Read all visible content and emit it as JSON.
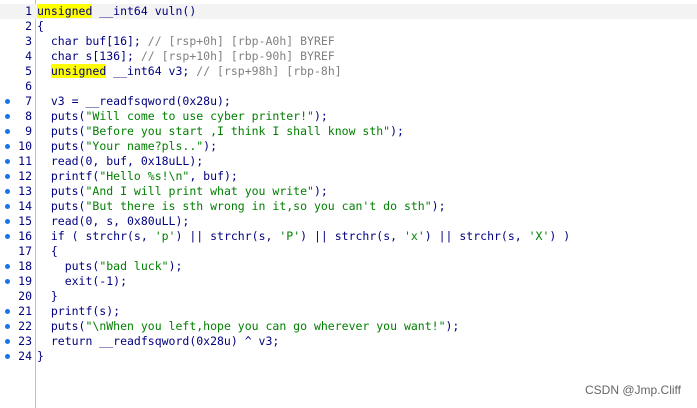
{
  "code": {
    "lines": [
      {
        "num": "1",
        "dot": false,
        "segs": [
          {
            "t": "unsigned",
            "c": "kw-hl"
          },
          {
            "t": " __int64 vuln()",
            "c": ""
          }
        ]
      },
      {
        "num": "2",
        "dot": false,
        "segs": [
          {
            "t": "{",
            "c": ""
          }
        ]
      },
      {
        "num": "3",
        "dot": false,
        "segs": [
          {
            "t": "  char buf[16]; ",
            "c": ""
          },
          {
            "t": "// [rsp+0h] [rbp-A0h] BYREF",
            "c": "cm"
          }
        ]
      },
      {
        "num": "4",
        "dot": false,
        "segs": [
          {
            "t": "  char s[136]; ",
            "c": ""
          },
          {
            "t": "// [rsp+10h] [rbp-90h] BYREF",
            "c": "cm"
          }
        ]
      },
      {
        "num": "5",
        "dot": false,
        "segs": [
          {
            "t": "  ",
            "c": ""
          },
          {
            "t": "unsigned",
            "c": "kw-hl"
          },
          {
            "t": " __int64 v3; ",
            "c": ""
          },
          {
            "t": "// [rsp+98h] [rbp-8h]",
            "c": "cm"
          }
        ]
      },
      {
        "num": "6",
        "dot": false,
        "segs": [
          {
            "t": "",
            "c": ""
          }
        ]
      },
      {
        "num": "7",
        "dot": true,
        "segs": [
          {
            "t": "  v3 = __readfsqword(0x28u);",
            "c": ""
          }
        ]
      },
      {
        "num": "8",
        "dot": true,
        "segs": [
          {
            "t": "  puts(",
            "c": ""
          },
          {
            "t": "\"Will come to use cyber printer!\"",
            "c": "str"
          },
          {
            "t": ");",
            "c": ""
          }
        ]
      },
      {
        "num": "9",
        "dot": true,
        "segs": [
          {
            "t": "  puts(",
            "c": ""
          },
          {
            "t": "\"Before you start ,I think I shall know sth\"",
            "c": "str"
          },
          {
            "t": ");",
            "c": ""
          }
        ]
      },
      {
        "num": "10",
        "dot": true,
        "segs": [
          {
            "t": "  puts(",
            "c": ""
          },
          {
            "t": "\"Your name?pls..\"",
            "c": "str"
          },
          {
            "t": ");",
            "c": ""
          }
        ]
      },
      {
        "num": "11",
        "dot": true,
        "segs": [
          {
            "t": "  read(0, buf, 0x18uLL);",
            "c": ""
          }
        ]
      },
      {
        "num": "12",
        "dot": true,
        "segs": [
          {
            "t": "  printf(",
            "c": ""
          },
          {
            "t": "\"Hello %s!\\n\"",
            "c": "str"
          },
          {
            "t": ", buf);",
            "c": ""
          }
        ]
      },
      {
        "num": "13",
        "dot": true,
        "segs": [
          {
            "t": "  puts(",
            "c": ""
          },
          {
            "t": "\"And I will print what you write\"",
            "c": "str"
          },
          {
            "t": ");",
            "c": ""
          }
        ]
      },
      {
        "num": "14",
        "dot": true,
        "segs": [
          {
            "t": "  puts(",
            "c": ""
          },
          {
            "t": "\"But there is sth wrong in it,so you can't do sth\"",
            "c": "str"
          },
          {
            "t": ");",
            "c": ""
          }
        ]
      },
      {
        "num": "15",
        "dot": true,
        "segs": [
          {
            "t": "  read(0, s, 0x80uLL);",
            "c": ""
          }
        ]
      },
      {
        "num": "16",
        "dot": true,
        "segs": [
          {
            "t": "  if ( strchr(s, ",
            "c": ""
          },
          {
            "t": "'p'",
            "c": "str"
          },
          {
            "t": ") || strchr(s, ",
            "c": ""
          },
          {
            "t": "'P'",
            "c": "str"
          },
          {
            "t": ") || strchr(s, ",
            "c": ""
          },
          {
            "t": "'x'",
            "c": "str"
          },
          {
            "t": ") || strchr(s, ",
            "c": ""
          },
          {
            "t": "'X'",
            "c": "str"
          },
          {
            "t": ") )",
            "c": ""
          }
        ]
      },
      {
        "num": "17",
        "dot": false,
        "segs": [
          {
            "t": "  {",
            "c": ""
          }
        ]
      },
      {
        "num": "18",
        "dot": true,
        "segs": [
          {
            "t": "    puts(",
            "c": ""
          },
          {
            "t": "\"bad luck\"",
            "c": "str"
          },
          {
            "t": ");",
            "c": ""
          }
        ]
      },
      {
        "num": "19",
        "dot": true,
        "segs": [
          {
            "t": "    exit(-1);",
            "c": ""
          }
        ]
      },
      {
        "num": "20",
        "dot": false,
        "segs": [
          {
            "t": "  }",
            "c": ""
          }
        ]
      },
      {
        "num": "21",
        "dot": true,
        "segs": [
          {
            "t": "  printf(s);",
            "c": ""
          }
        ]
      },
      {
        "num": "22",
        "dot": true,
        "segs": [
          {
            "t": "  puts(",
            "c": ""
          },
          {
            "t": "\"\\nWhen you left,hope you can go wherever you want!\"",
            "c": "str"
          },
          {
            "t": ");",
            "c": ""
          }
        ]
      },
      {
        "num": "23",
        "dot": true,
        "segs": [
          {
            "t": "  return __readfsqword(0x28u) ^ v3;",
            "c": ""
          }
        ]
      },
      {
        "num": "24",
        "dot": true,
        "segs": [
          {
            "t": "}",
            "c": ""
          }
        ]
      }
    ]
  },
  "watermark": "CSDN @Jmp.Cliff",
  "colors": {
    "keyword_highlight": "#ffff00",
    "comment": "#808080",
    "string": "#008000",
    "code_text": "#000080",
    "breakpoint_dot": "#1a73e8"
  }
}
